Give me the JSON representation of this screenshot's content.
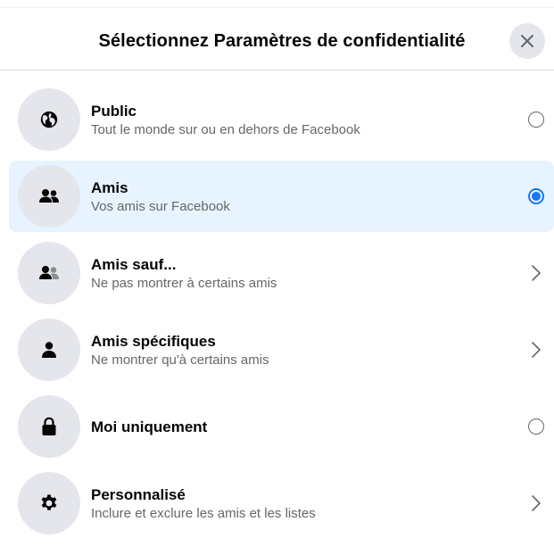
{
  "dialog": {
    "title": "Sélectionnez Paramètres de confidentialité"
  },
  "options": [
    {
      "title": "Public",
      "subtitle": "Tout le monde sur ou en dehors de Facebook",
      "icon": "globe-icon",
      "control": "radio",
      "selected": false
    },
    {
      "title": "Amis",
      "subtitle": "Vos amis sur Facebook",
      "icon": "friends-icon",
      "control": "radio",
      "selected": true
    },
    {
      "title": "Amis sauf...",
      "subtitle": "Ne pas montrer à certains amis",
      "icon": "friends-except-icon",
      "control": "chevron",
      "selected": false
    },
    {
      "title": "Amis spécifiques",
      "subtitle": "Ne montrer qu'à certains amis",
      "icon": "person-icon",
      "control": "chevron",
      "selected": false
    },
    {
      "title": "Moi uniquement",
      "subtitle": "",
      "icon": "lock-icon",
      "control": "radio",
      "selected": false
    },
    {
      "title": "Personnalisé",
      "subtitle": "Inclure et exclure les amis et les listes",
      "icon": "gear-icon",
      "control": "chevron",
      "selected": false
    }
  ],
  "colors": {
    "accent": "#1877f2",
    "selected_bg": "#e7f3ff",
    "icon_bg": "#e4e6eb",
    "secondary_text": "#65676b"
  }
}
